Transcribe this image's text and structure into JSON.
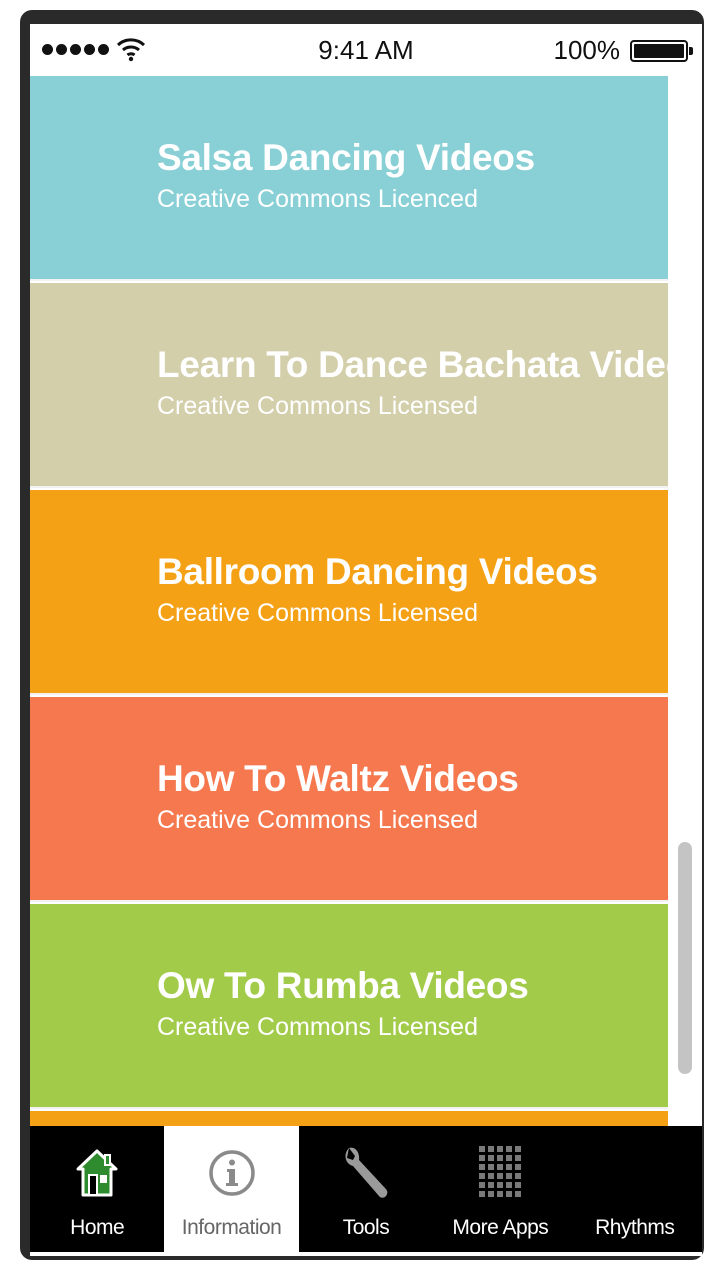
{
  "status_bar": {
    "time": "9:41 AM",
    "battery_percent": "100%",
    "signal_icon": "signal-dots-icon",
    "wifi_icon": "wifi-icon",
    "battery_icon": "battery-full-icon"
  },
  "list": {
    "items": [
      {
        "title": "Salsa Dancing Videos",
        "subtitle": "Creative Commons Licenced",
        "color": "#88d0d6"
      },
      {
        "title": "Learn To Dance Bachata Videos",
        "subtitle": "Creative Commons Licensed",
        "color": "#d3cfab"
      },
      {
        "title": "Ballroom Dancing Videos",
        "subtitle": "Creative Commons Licensed",
        "color": "#f4a116"
      },
      {
        "title": "How To Waltz Videos",
        "subtitle": "Creative Commons Licensed",
        "color": "#f5784e"
      },
      {
        "title": "Ow To Rumba Videos",
        "subtitle": "Creative Commons Licensed",
        "color": "#a2cb4a"
      },
      {
        "title": "",
        "subtitle": "",
        "color": "#f4a116"
      }
    ]
  },
  "tab_bar": {
    "tabs": [
      {
        "label": "Home",
        "icon": "home-icon",
        "active": false
      },
      {
        "label": "Information",
        "icon": "info-icon",
        "active": true
      },
      {
        "label": "Tools",
        "icon": "wrench-icon",
        "active": false
      },
      {
        "label": "More Apps",
        "icon": "grid-icon",
        "active": false
      },
      {
        "label": "Rhythms",
        "icon": "",
        "active": false
      }
    ]
  },
  "colors": {
    "frame": "#2a2a2a",
    "tab_bar_bg": "#000000",
    "home_icon_green": "#2e8b2e"
  }
}
